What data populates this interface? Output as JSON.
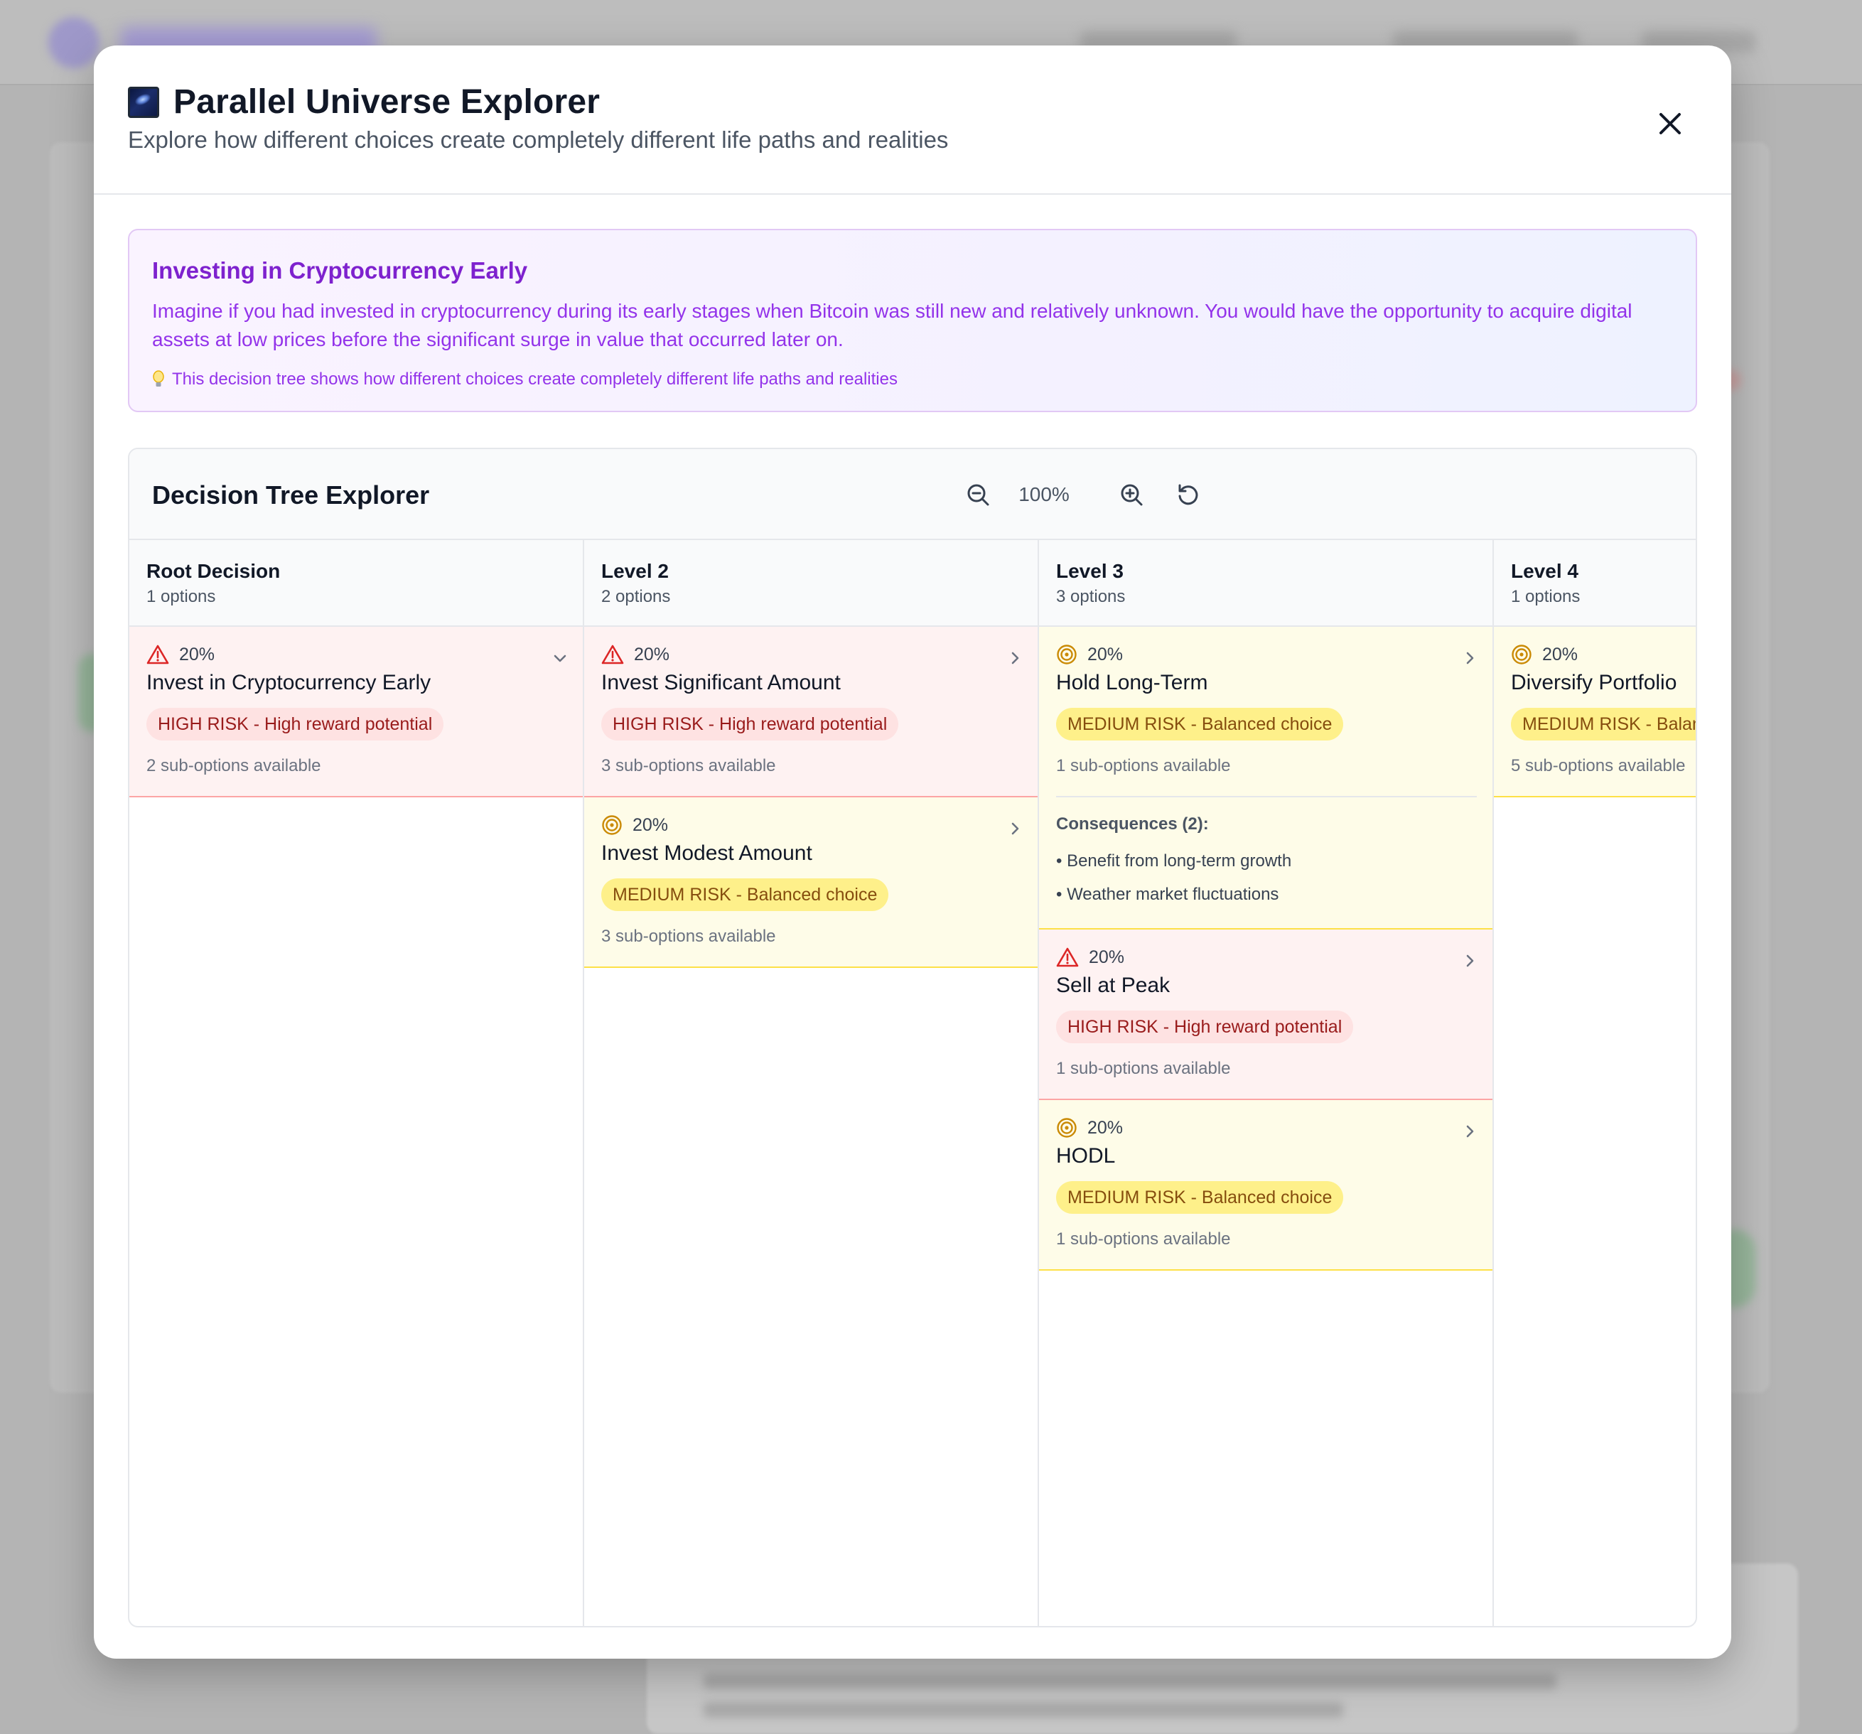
{
  "modal": {
    "title": "Parallel Universe Explorer",
    "subtitle": "Explore how different choices create completely different life paths and realities",
    "close_icon": "close-icon"
  },
  "scenario": {
    "title": "Investing in Cryptocurrency Early",
    "description": "Imagine if you had invested in cryptocurrency during its early stages when Bitcoin was still new and relatively unknown. You would have the opportunity to acquire digital assets at low prices before the significant surge in value that occurred later on.",
    "hint": "This decision tree shows how different choices create completely different life paths and realities"
  },
  "tree": {
    "title": "Decision Tree Explorer",
    "zoom_level": "100%",
    "columns": [
      {
        "title": "Root Decision",
        "count": "1 options",
        "cards": [
          {
            "pct": "20%",
            "title": "Invest in Cryptocurrency Early",
            "risk": "high",
            "badge": "HIGH RISK - High reward potential",
            "sub": "2 sub-options available",
            "chevron": "chevron-down-icon"
          }
        ]
      },
      {
        "title": "Level 2",
        "count": "2 options",
        "cards": [
          {
            "pct": "20%",
            "title": "Invest Significant Amount",
            "risk": "high",
            "badge": "HIGH RISK - High reward potential",
            "sub": "3 sub-options available",
            "chevron": "chevron-right-icon"
          },
          {
            "pct": "20%",
            "title": "Invest Modest Amount",
            "risk": "medium",
            "badge": "MEDIUM RISK - Balanced choice",
            "sub": "3 sub-options available",
            "chevron": "chevron-right-icon"
          }
        ]
      },
      {
        "title": "Level 3",
        "count": "3 options",
        "cards": [
          {
            "pct": "20%",
            "title": "Hold Long-Term",
            "risk": "medium",
            "badge": "MEDIUM RISK - Balanced choice",
            "sub": "1 sub-options available",
            "chevron": "chevron-right-icon",
            "consequences": {
              "title": "Consequences (2):",
              "items": [
                "• Benefit from long-term growth",
                "• Weather market fluctuations"
              ]
            }
          },
          {
            "pct": "20%",
            "title": "Sell at Peak",
            "risk": "high",
            "badge": "HIGH RISK - High reward potential",
            "sub": "1 sub-options available",
            "chevron": "chevron-right-icon"
          },
          {
            "pct": "20%",
            "title": "HODL",
            "risk": "medium",
            "badge": "MEDIUM RISK - Balanced choice",
            "sub": "1 sub-options available",
            "chevron": "chevron-right-icon"
          }
        ]
      },
      {
        "title": "Level 4",
        "count": "1 options",
        "cards": [
          {
            "pct": "20%",
            "title": "Diversify Portfolio",
            "risk": "medium",
            "badge": "MEDIUM RISK - Balanced choice",
            "sub": "5 sub-options available",
            "chevron": "chevron-right-icon"
          }
        ]
      }
    ]
  },
  "colors": {
    "high_bg": "#fef2f2",
    "high_border": "#fca5a5",
    "high_icon": "#dc2626",
    "medium_bg": "#fefce8",
    "medium_border": "#fde047",
    "medium_icon": "#ca8a04",
    "accent_purple": "#9333ea"
  }
}
